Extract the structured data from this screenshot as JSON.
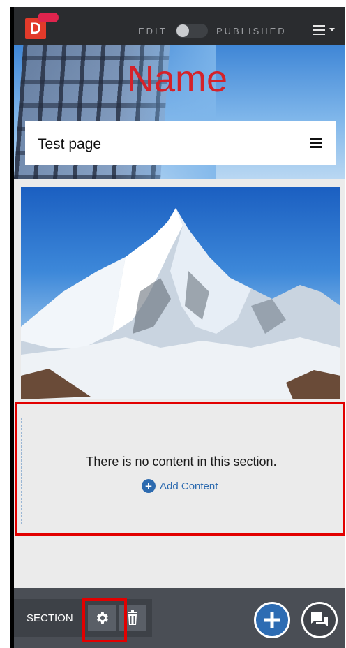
{
  "topbar": {
    "logo": "D",
    "edit_label": "EDIT",
    "published_label": "PUBLISHED",
    "toggle_state": "edit",
    "menu_icon": "hamburger-icon"
  },
  "hero": {
    "site_name": "Name",
    "nav_title": "Test page",
    "nav_menu_icon": "hamburger-icon"
  },
  "section": {
    "empty_text": "There is no content in this section.",
    "add_content_label": "Add Content",
    "add_icon": "plus-circle-icon"
  },
  "bottombar": {
    "section_label": "SECTION",
    "settings_icon": "gear-icon",
    "delete_icon": "trash-icon",
    "add_icon": "plus-icon",
    "chat_icon": "chat-icon"
  },
  "colors": {
    "accent_red": "#e20000",
    "brand_red": "#e23a2a",
    "site_name_red": "#d4222a",
    "link_blue": "#2c6aaf",
    "toolbar": "#4a4e55",
    "topbar": "#2a2c2f"
  }
}
